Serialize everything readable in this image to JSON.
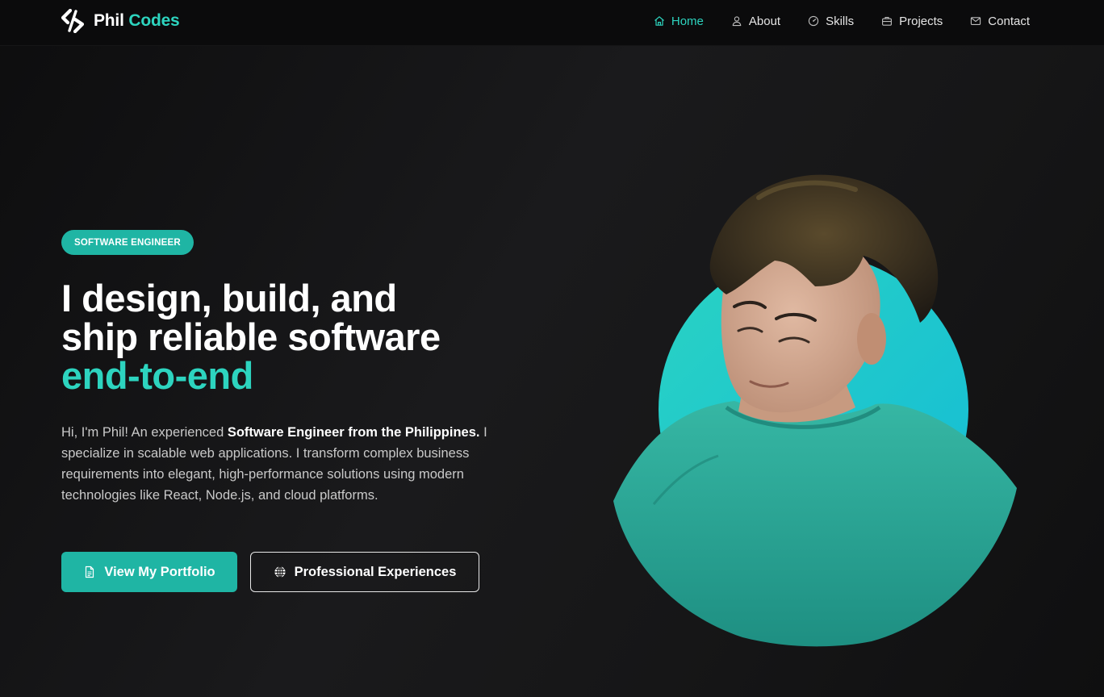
{
  "brand": {
    "name_first": "Phil",
    "name_second": "Codes",
    "accent_color": "#2dd4bf",
    "logo_icon": "slash-code-logo-icon"
  },
  "nav": {
    "items": [
      {
        "label": "Home",
        "icon": "home-icon",
        "active": true
      },
      {
        "label": "About",
        "icon": "user-icon",
        "active": false
      },
      {
        "label": "Skills",
        "icon": "gauge-icon",
        "active": false
      },
      {
        "label": "Projects",
        "icon": "briefcase-icon",
        "active": false
      },
      {
        "label": "Contact",
        "icon": "mail-icon",
        "active": false
      }
    ]
  },
  "hero": {
    "badge": "SOFTWARE ENGINEER",
    "headline_line1": "I design, build, and",
    "headline_line2": "ship reliable software",
    "headline_accent": "end-to-end",
    "intro_lead": "Hi, I'm Phil! An experienced ",
    "intro_bold": "Software Engineer from the Philippines.",
    "intro_rest": " I specialize in scalable web applications. I transform complex business requirements into elegant, high-performance solutions using modern technologies like React, Node.js, and cloud platforms.",
    "primary_button": "View My Portfolio",
    "primary_button_icon": "document-icon",
    "secondary_button": "Professional Experiences",
    "secondary_button_icon": "globe-icon"
  },
  "colors": {
    "background": "#111112",
    "accent": "#2dd4bf",
    "button_fill": "#1fb5a4",
    "text": "#ffffff",
    "muted_text": "#c9c9c9"
  }
}
